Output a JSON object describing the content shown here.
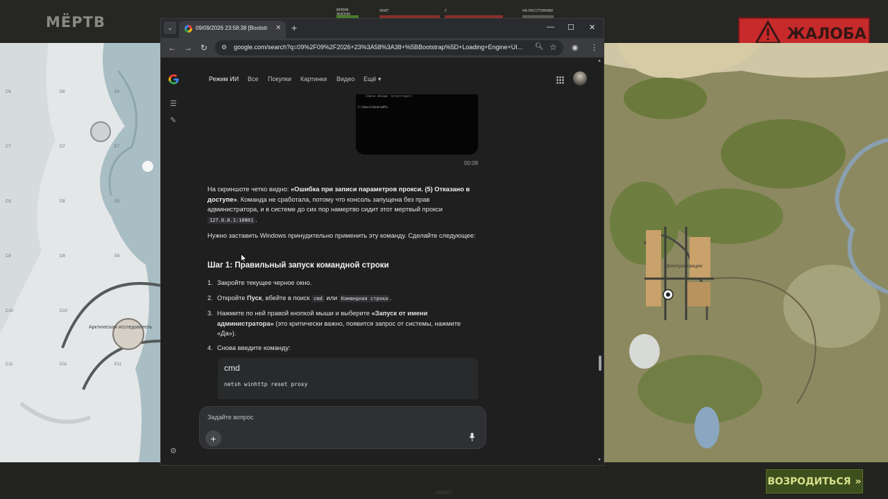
{
  "game": {
    "dead_label": "МЁРТВ",
    "report_label": "ЖАЛОБА",
    "respawn_label": "ВОЗРОДИТЬСЯ",
    "bottom_id": "163407",
    "hud": [
      {
        "label": "ВРЕМЯ ЖИЗНИ",
        "color": "#4a7a2a"
      },
      {
        "label": "УБИТ",
        "color": "#8a2f2a"
      },
      {
        "label": "С",
        "color": "#8a2f2a"
      },
      {
        "label": "НА РАССТОЯНИИ",
        "color": "#5a5a55"
      }
    ],
    "map_left": {
      "place_label": "Арктическая исследователь",
      "grid_labels": [
        "C6",
        "D6",
        "E6",
        "C7",
        "D7",
        "E7",
        "C8",
        "D8",
        "E8",
        "C9",
        "D9",
        "E9",
        "C10",
        "D10",
        "C11",
        "D11",
        "E11"
      ]
    },
    "map_right": {
      "place_label": "Электростанция"
    },
    "colors": {
      "report": "#c62a2a",
      "respawn": "#3d4f1d",
      "respawn_text": "#d6e08a"
    }
  },
  "browser": {
    "tab_title": "09/09/2026 23:58:38 [Bootstrap] Loading Engine",
    "url": "google.com/search?q=09%2F09%2F2026+23%3A58%3A38+%5BBootstrap%5D+Loading+Engine+UI...",
    "window_controls": [
      "—",
      "☐",
      "✕"
    ]
  },
  "google": {
    "nav": [
      "Режим ИИ",
      "Все",
      "Покупки",
      "Картинки",
      "Видео",
      "Ещё ▾"
    ],
    "screenshot_text_1": "Список обхода: (отсутствует)",
    "screenshot_text_2": "C:\\Users\\AsdronPC>",
    "timestamp": "00:08",
    "para1_pre": "На скриншоте четко видно: ",
    "para1_bold": "«Ошибка при записи параметров прокси. (5) Отказано в доступе»",
    "para1_post": ". Команда не сработала, потому что консоль запущена без прав администратора, и в системе до сих пор намертво сидит этот мертвый прокси ",
    "para1_code": "127.0.0.1:10801",
    "para1_end": ".",
    "para2": "Нужно заставить Windows принудительно применить эту команду. Сделайте следующее:",
    "heading": "Шаг 1: Правильный запуск командной строки",
    "step1_num": "1.",
    "step1": "Закройте текущее черное окно.",
    "step2_num": "2.",
    "step2_pre": "Откройте ",
    "step2_bold": "Пуск",
    "step2_mid": ", вбейте в поиск ",
    "step2_code1": "cmd",
    "step2_or": " или ",
    "step2_code2": "Командная строка",
    "step2_end": ".",
    "step3_num": "3.",
    "step3_pre": "Нажмите по ней правой кнопкой мыши и выберите ",
    "step3_bold": "«Запуск от имени администратора»",
    "step3_post": " (это критически важно, появится запрос от системы, нажмите «Да»).",
    "step4_num": "4.",
    "step4": "Снова введите команду:",
    "code_lang": "cmd",
    "code_cmd": "netsh winhttp reset proxy",
    "ask_placeholder": "Задайте вопрос",
    "scroll_fraction": 0.77
  }
}
